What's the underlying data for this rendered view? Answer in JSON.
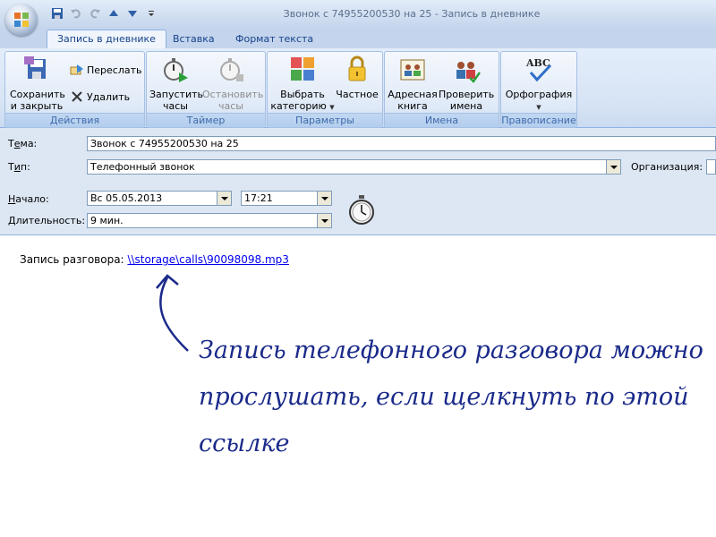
{
  "window": {
    "title": "Звонок с 74955200530 на 25  -  Запись в дневнике"
  },
  "tabs": [
    {
      "label": "Запись в дневнике",
      "active": true
    },
    {
      "label": "Вставка",
      "active": false
    },
    {
      "label": "Формат текста",
      "active": false
    }
  ],
  "ribbon": {
    "actions": {
      "label": "Действия",
      "save_close": [
        "Сохранить",
        "и закрыть"
      ],
      "forward": "Переслать",
      "delete": "Удалить"
    },
    "timer": {
      "label": "Таймер",
      "start": [
        "Запустить",
        "часы"
      ],
      "stop": [
        "Остановить",
        "часы"
      ]
    },
    "options": {
      "label": "Параметры",
      "category": [
        "Выбрать",
        "категорию"
      ],
      "private": "Частное"
    },
    "names": {
      "label": "Имена",
      "address_book": [
        "Адресная",
        "книга"
      ],
      "check_names": [
        "Проверить",
        "имена"
      ]
    },
    "proofing": {
      "label": "Правописание",
      "spelling": "Орфография",
      "abc": "ABC"
    }
  },
  "form": {
    "subject": {
      "label_pre": "Т",
      "label_acc": "е",
      "label_post": "ма:",
      "value": "Звонок с 74955200530 на 25"
    },
    "type": {
      "label_pre": "Т",
      "label_acc": "и",
      "label_post": "п:",
      "value": "Телефонный звонок"
    },
    "company": {
      "label": "Организация:"
    },
    "start": {
      "label_pre": "",
      "label_acc": "Н",
      "label_post": "ачало:",
      "date": "Вс 05.05.2013",
      "time": "17:21"
    },
    "duration": {
      "label_pre": "",
      "label_acc": "Д",
      "label_post": "лительность:",
      "value": "9 мин."
    }
  },
  "body": {
    "prefix": "Запись разговора:",
    "link": "\\\\storage\\calls\\90098098.mp3",
    "annotation": [
      "Запись телефонного разговора можно",
      "прослушать, если щелкнуть по этой",
      "ссылке"
    ]
  },
  "colors": {
    "link": "#0000ee",
    "annotation": "#1a2a8a",
    "accent": "#15428b"
  }
}
